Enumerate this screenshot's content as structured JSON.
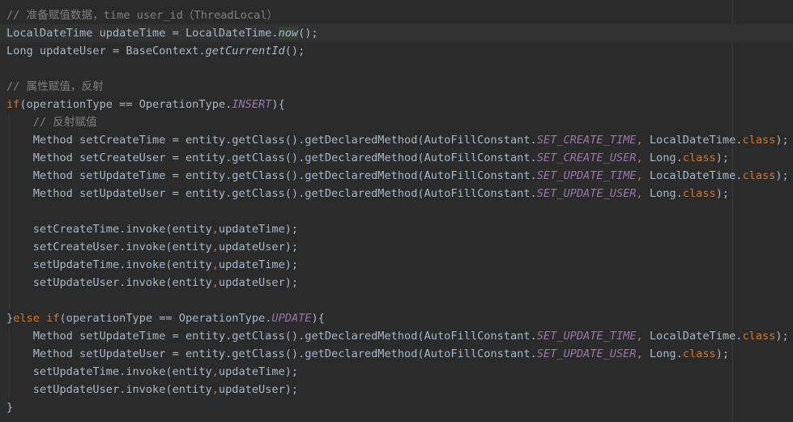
{
  "colors": {
    "background": "#2b2b2b",
    "current_line": "#323232",
    "default_text": "#a9b7c6",
    "comment": "#808080",
    "keyword": "#cc7832",
    "static_field": "#9876aa",
    "highlight": "#344134"
  },
  "lines": [
    {
      "current": false,
      "tokens": [
        {
          "t": "// 准备赋值数据，time user_id（ThreadLocal）",
          "c": "comment"
        }
      ]
    },
    {
      "current": true,
      "tokens": [
        {
          "t": "LocalDateTime updateTime = LocalDateTime.",
          "c": "default"
        },
        {
          "t": "now",
          "c": "method-static-hl"
        },
        {
          "t": "();",
          "c": "default"
        }
      ]
    },
    {
      "current": false,
      "tokens": [
        {
          "t": "Long updateUser = BaseContext.",
          "c": "default"
        },
        {
          "t": "getCurrentId",
          "c": "method-static"
        },
        {
          "t": "();",
          "c": "default"
        }
      ]
    },
    {
      "current": false,
      "tokens": []
    },
    {
      "current": false,
      "tokens": [
        {
          "t": "// 属性赋值，反射",
          "c": "comment"
        }
      ]
    },
    {
      "current": false,
      "tokens": [
        {
          "t": "if",
          "c": "keyword"
        },
        {
          "t": "(operationType == OperationType.",
          "c": "default"
        },
        {
          "t": "INSERT",
          "c": "static"
        },
        {
          "t": "){",
          "c": "default"
        }
      ]
    },
    {
      "current": false,
      "tokens": [
        {
          "t": "    ",
          "c": "default"
        },
        {
          "t": "// 反射赋值",
          "c": "comment"
        }
      ]
    },
    {
      "current": false,
      "tokens": [
        {
          "t": "    Method setCreateTime = entity.getClass().getDeclaredMethod(AutoFillConstant.",
          "c": "default"
        },
        {
          "t": "SET_CREATE_TIME",
          "c": "static"
        },
        {
          "t": ", ",
          "c": "keyword"
        },
        {
          "t": "LocalDateTime.",
          "c": "default"
        },
        {
          "t": "class",
          "c": "keyword"
        },
        {
          "t": ");",
          "c": "default"
        }
      ]
    },
    {
      "current": false,
      "tokens": [
        {
          "t": "    Method setCreateUser = entity.getClass().getDeclaredMethod(AutoFillConstant.",
          "c": "default"
        },
        {
          "t": "SET_CREATE_USER",
          "c": "static"
        },
        {
          "t": ", ",
          "c": "keyword"
        },
        {
          "t": "Long.",
          "c": "default"
        },
        {
          "t": "class",
          "c": "keyword"
        },
        {
          "t": ");",
          "c": "default"
        }
      ]
    },
    {
      "current": false,
      "tokens": [
        {
          "t": "    Method setUpdateTime = entity.getClass().getDeclaredMethod(AutoFillConstant.",
          "c": "default"
        },
        {
          "t": "SET_UPDATE_TIME",
          "c": "static"
        },
        {
          "t": ", ",
          "c": "keyword"
        },
        {
          "t": "LocalDateTime.",
          "c": "default"
        },
        {
          "t": "class",
          "c": "keyword"
        },
        {
          "t": ");",
          "c": "default"
        }
      ]
    },
    {
      "current": false,
      "tokens": [
        {
          "t": "    Method setUpdateUser = entity.getClass().getDeclaredMethod(AutoFillConstant.",
          "c": "default"
        },
        {
          "t": "SET_UPDATE_USER",
          "c": "static"
        },
        {
          "t": ", ",
          "c": "keyword"
        },
        {
          "t": "Long.",
          "c": "default"
        },
        {
          "t": "class",
          "c": "keyword"
        },
        {
          "t": ");",
          "c": "default"
        }
      ]
    },
    {
      "current": false,
      "tokens": []
    },
    {
      "current": false,
      "tokens": [
        {
          "t": "    setCreateTime.invoke(entity",
          "c": "default"
        },
        {
          "t": ",",
          "c": "keyword"
        },
        {
          "t": "updateTime);",
          "c": "default"
        }
      ]
    },
    {
      "current": false,
      "tokens": [
        {
          "t": "    setCreateUser.invoke(entity",
          "c": "default"
        },
        {
          "t": ",",
          "c": "keyword"
        },
        {
          "t": "updateUser);",
          "c": "default"
        }
      ]
    },
    {
      "current": false,
      "tokens": [
        {
          "t": "    setUpdateTime.invoke(entity",
          "c": "default"
        },
        {
          "t": ",",
          "c": "keyword"
        },
        {
          "t": "updateTime);",
          "c": "default"
        }
      ]
    },
    {
      "current": false,
      "tokens": [
        {
          "t": "    setUpdateUser.invoke(entity",
          "c": "default"
        },
        {
          "t": ",",
          "c": "keyword"
        },
        {
          "t": "updateUser);",
          "c": "default"
        }
      ]
    },
    {
      "current": false,
      "tokens": []
    },
    {
      "current": false,
      "tokens": [
        {
          "t": "}",
          "c": "default"
        },
        {
          "t": "else if",
          "c": "keyword"
        },
        {
          "t": "(operationType == OperationType.",
          "c": "default"
        },
        {
          "t": "UPDATE",
          "c": "static"
        },
        {
          "t": "){",
          "c": "default"
        }
      ]
    },
    {
      "current": false,
      "tokens": [
        {
          "t": "    Method setUpdateTime = entity.getClass().getDeclaredMethod(AutoFillConstant.",
          "c": "default"
        },
        {
          "t": "SET_UPDATE_TIME",
          "c": "static"
        },
        {
          "t": ", ",
          "c": "keyword"
        },
        {
          "t": "LocalDateTime.",
          "c": "default"
        },
        {
          "t": "class",
          "c": "keyword"
        },
        {
          "t": ");",
          "c": "default"
        }
      ]
    },
    {
      "current": false,
      "tokens": [
        {
          "t": "    Method setUpdateUser = entity.getClass().getDeclaredMethod(AutoFillConstant.",
          "c": "default"
        },
        {
          "t": "SET_UPDATE_USER",
          "c": "static"
        },
        {
          "t": ", ",
          "c": "keyword"
        },
        {
          "t": "Long.",
          "c": "default"
        },
        {
          "t": "class",
          "c": "keyword"
        },
        {
          "t": ");",
          "c": "default"
        }
      ]
    },
    {
      "current": false,
      "tokens": [
        {
          "t": "    setUpdateTime.invoke(entity",
          "c": "default"
        },
        {
          "t": ",",
          "c": "keyword"
        },
        {
          "t": "updateTime);",
          "c": "default"
        }
      ]
    },
    {
      "current": false,
      "tokens": [
        {
          "t": "    setUpdateUser.invoke(entity",
          "c": "default"
        },
        {
          "t": ",",
          "c": "keyword"
        },
        {
          "t": "updateUser);",
          "c": "default"
        }
      ]
    },
    {
      "current": false,
      "tokens": [
        {
          "t": "}",
          "c": "default"
        }
      ]
    }
  ]
}
